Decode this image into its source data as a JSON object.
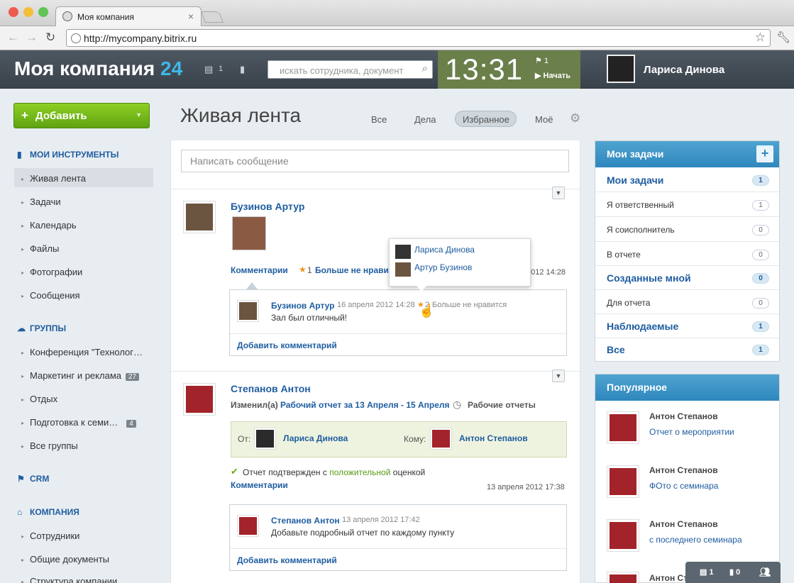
{
  "browser": {
    "tab_title": "Моя компания",
    "tab_close": "×",
    "url": "http://mycompany.bitrix.ru"
  },
  "header": {
    "company": "Моя компания",
    "company_count": "24",
    "messages_count": "1",
    "search_placeholder": "искать сотрудника, документ",
    "time": "13:31",
    "flag_count": "1",
    "start_label": "Начать",
    "user_name": "Лариса Динова"
  },
  "sidebar": {
    "add_button": "Добавить",
    "sections": [
      {
        "title": "Мои инструменты"
      },
      {
        "title": "Группы"
      },
      {
        "title": "CRM"
      },
      {
        "title": "Компания"
      }
    ],
    "tools": [
      "Живая лента",
      "Задачи",
      "Календарь",
      "Файлы",
      "Фотографии",
      "Сообщения"
    ],
    "groups": [
      {
        "label": "Конференция \"Технолог…",
        "count": ""
      },
      {
        "label": "Маркетинг и реклама",
        "count": "27"
      },
      {
        "label": "Отдых",
        "count": ""
      },
      {
        "label": "Подготовка к семи…",
        "count": "4"
      },
      {
        "label": "Все группы",
        "count": ""
      }
    ],
    "company_items": [
      "Сотрудники",
      "Общие документы",
      "Структура компании"
    ]
  },
  "feed": {
    "title": "Живая лента",
    "filters": [
      "Все",
      "Дела",
      "Избранное",
      "Моё"
    ],
    "compose_placeholder": "Написать сообщение",
    "post1": {
      "author": "Бузинов Артур",
      "comments_link": "Комментарии",
      "likes": "1",
      "unlike": "Больше не нравит",
      "date": "2012 14:28",
      "comment": {
        "author": "Бузинов Артур",
        "date": "16 апреля 2012 14:28",
        "likes": "2",
        "unlike": "Больше не нравится",
        "text": "Зал был отличный!"
      },
      "add_comment": "Добавить комментарий"
    },
    "popup": [
      "Лариса Динова",
      "Артур Бузинов"
    ],
    "post2": {
      "author": "Степанов Антон",
      "action": "Изменил(а)",
      "report_link": "Рабочий отчет за 13 Апреля - 15 Апреля",
      "report_type": "Рабочие отчеты",
      "from_label": "От:",
      "from_name": "Лариса Динова",
      "to_label": "Кому:",
      "to_name": "Антон Степанов",
      "confirm_prefix": "Отчет подтвержден с",
      "confirm_mid": "положительной",
      "confirm_suffix": "оценкой",
      "comments_link": "Комментарии",
      "date": "13 апреля 2012 17:38",
      "comment": {
        "author": "Степанов Антон",
        "date": "13 апреля 2012 17:42",
        "text": "Добавьте подробный отчет по каждому пункту"
      },
      "add_comment": "Добавить комментарий"
    }
  },
  "tasks": {
    "title": "Мои задачи",
    "rows": [
      {
        "label": "Мои задачи",
        "count": "1",
        "bold": true
      },
      {
        "label": "Я ответственный",
        "count": "1",
        "bold": false
      },
      {
        "label": "Я соисполнитель",
        "count": "0",
        "bold": false
      },
      {
        "label": "В отчете",
        "count": "0",
        "bold": false
      },
      {
        "label": "Созданные мной",
        "count": "0",
        "bold": true
      },
      {
        "label": "Для отчета",
        "count": "0",
        "bold": false
      },
      {
        "label": "Наблюдаемые",
        "count": "1",
        "bold": true
      },
      {
        "label": "Все",
        "count": "1",
        "bold": true
      }
    ]
  },
  "popular": {
    "title": "Популярное",
    "items": [
      {
        "name": "Антон Степанов",
        "link": "Отчет о мероприятии"
      },
      {
        "name": "Антон Степанов",
        "link": "ФОто с семинара"
      },
      {
        "name": "Антон Степанов",
        "link": "с последнего семинара"
      },
      {
        "name": "Антон Степанов",
        "link": ""
      }
    ]
  },
  "bottombar": {
    "messages": "1",
    "notifications": "0"
  },
  "colors": {
    "accent": "#1f5da0",
    "green": "#6aab18",
    "clock_bg": "#6a7f4a",
    "header_bg": "#434c55"
  }
}
